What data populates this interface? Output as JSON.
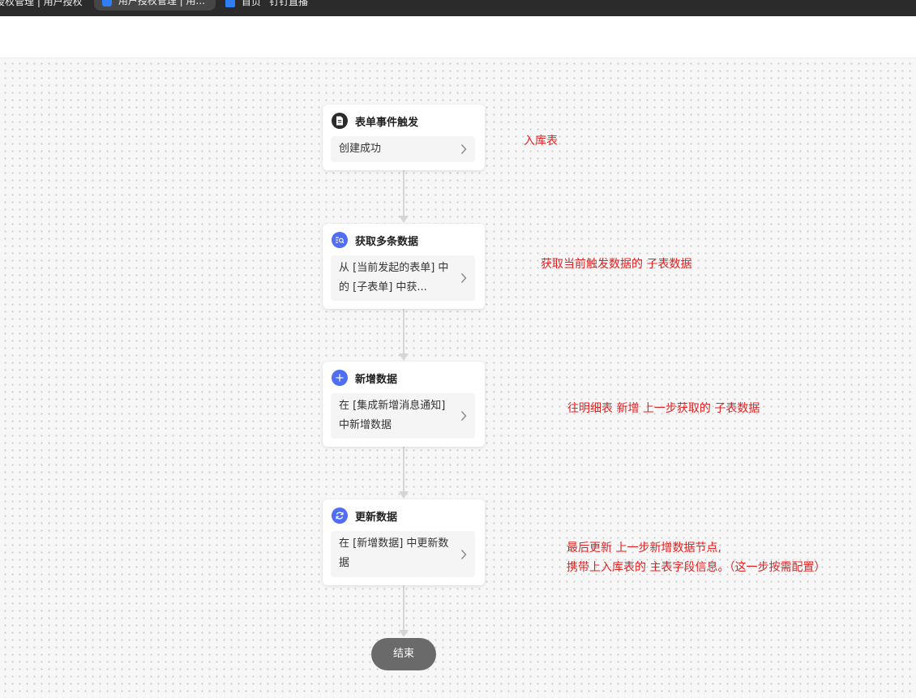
{
  "browser": {
    "bookmarks": [
      {
        "label": "授权管理 | 用户授权"
      },
      {
        "label": "用户授权管理 | 用..."
      },
      {
        "label": "首页"
      },
      {
        "label": "钉钉直播"
      }
    ]
  },
  "flow": {
    "nodes": [
      {
        "title": "表单事件触发",
        "body": "创建成功",
        "icon": "form-document-icon"
      },
      {
        "title": "获取多条数据",
        "body": "从 [当前发起的表单] 中的 [子表单] 中获...",
        "icon": "query-data-icon"
      },
      {
        "title": "新增数据",
        "body": "在 [集成新增消息通知] 中新增数据",
        "icon": "plus-icon"
      },
      {
        "title": "更新数据",
        "body": "在 [新增数据] 中更新数据",
        "icon": "refresh-icon"
      }
    ],
    "end_label": "结束"
  },
  "annotations": [
    {
      "text": "入库表"
    },
    {
      "text": "获取当前触发数据的 子表数据"
    },
    {
      "text": "往明细表 新增 上一步获取的 子表数据"
    },
    {
      "text": "最后更新 上一步新增数据节点,"
    },
    {
      "text": "携带上入库表的 主表字段信息。（这一步按需配置）"
    }
  ],
  "colors": {
    "annotation": "#e02020",
    "trigger_icon_bg": "#2a2a2a",
    "action_icon_bg": "#4f6df5",
    "end_pill_bg": "#6a6a6a"
  }
}
